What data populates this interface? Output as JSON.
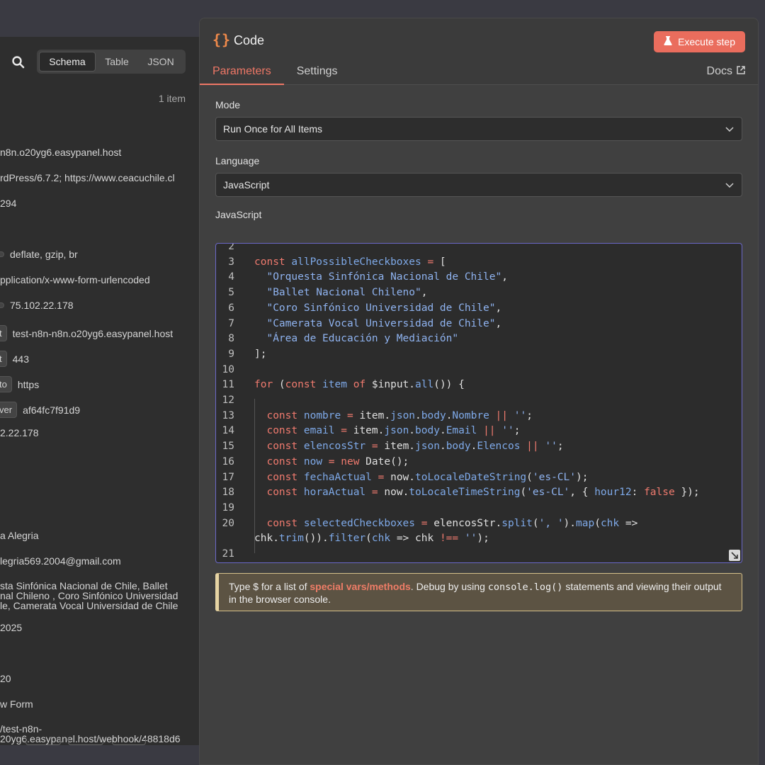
{
  "left_panel": {
    "view_tabs": [
      "Schema",
      "Table",
      "JSON"
    ],
    "active_view": "Schema",
    "item_count": "1 item",
    "rows": [
      {
        "text": "n8n.o20yg6.easypanel.host"
      },
      {
        "text": "rdPress/6.7.2; https://www.ceacuchile.cl"
      },
      {
        "text": "294"
      },
      {
        "key": "",
        "text": "deflate, gzip, br"
      },
      {
        "text": "pplication/x-www-form-urlencoded"
      },
      {
        "key": "",
        "text": "75.102.22.178"
      },
      {
        "key": "t",
        "text": "test-n8n-n8n.o20yg6.easypanel.host"
      },
      {
        "key": "t",
        "text": "443"
      },
      {
        "key": "to",
        "text": "https"
      },
      {
        "key": "ver",
        "text": "af64fc7f91d9"
      },
      {
        "text": "2.22.178"
      },
      {
        "text": "a Alegria"
      },
      {
        "text": "legria569.2004@gmail.com"
      },
      {
        "text": "sta Sinfónica Nacional de Chile, Ballet\nnal Chileno , Coro Sinfónico Universidad\nle, Camerata Vocal Universidad de Chile"
      },
      {
        "text": "2025"
      },
      {
        "text": "20"
      },
      {
        "text": "w Form"
      },
      {
        "text": "/test-n8n-\n20yg6.easypanel.host/webhook/48818d6"
      }
    ]
  },
  "dialog": {
    "icon_glyph": "{}",
    "title": "Code",
    "execute_label": "Execute step",
    "tabs": [
      "Parameters",
      "Settings"
    ],
    "active_tab": "Parameters",
    "docs_label": "Docs",
    "mode_label": "Mode",
    "mode_value": "Run Once for All Items",
    "language_label": "Language",
    "language_value": "JavaScript",
    "code_label": "JavaScript",
    "code_lines": [
      {
        "n": "2",
        "tokens": []
      },
      {
        "n": "3",
        "tokens": [
          [
            "kw",
            "const "
          ],
          [
            "vr",
            "allPossibleCheckboxes"
          ],
          [
            "kw",
            " = "
          ],
          [
            "",
            "["
          ]
        ]
      },
      {
        "n": "4",
        "tokens": [
          [
            "",
            "  "
          ],
          [
            "st",
            "\"Orquesta Sinfónica Nacional de Chile\""
          ],
          [
            "",
            ","
          ]
        ]
      },
      {
        "n": "5",
        "tokens": [
          [
            "",
            "  "
          ],
          [
            "st",
            "\"Ballet Nacional Chileno\""
          ],
          [
            "",
            ","
          ]
        ]
      },
      {
        "n": "6",
        "tokens": [
          [
            "",
            "  "
          ],
          [
            "st",
            "\"Coro Sinfónico Universidad de Chile\""
          ],
          [
            "",
            ","
          ]
        ]
      },
      {
        "n": "7",
        "tokens": [
          [
            "",
            "  "
          ],
          [
            "st",
            "\"Camerata Vocal Universidad de Chile\""
          ],
          [
            "",
            ","
          ]
        ]
      },
      {
        "n": "8",
        "tokens": [
          [
            "",
            "  "
          ],
          [
            "st",
            "\"Área de Educación y Mediación\""
          ]
        ]
      },
      {
        "n": "9",
        "tokens": [
          [
            "",
            "];"
          ]
        ]
      },
      {
        "n": "10",
        "tokens": []
      },
      {
        "n": "11",
        "tokens": [
          [
            "kw",
            "for "
          ],
          [
            "",
            "("
          ],
          [
            "kw",
            "const "
          ],
          [
            "vr",
            "item "
          ],
          [
            "kw",
            "of "
          ],
          [
            "",
            "$input."
          ],
          [
            "fn",
            "all"
          ],
          [
            "",
            "()) {"
          ]
        ]
      },
      {
        "n": "12",
        "tokens": []
      },
      {
        "n": "13",
        "tokens": [
          [
            "",
            "  "
          ],
          [
            "kw",
            "const "
          ],
          [
            "vr",
            "nombre"
          ],
          [
            "kw",
            " = "
          ],
          [
            "",
            "item."
          ],
          [
            "fn",
            "json"
          ],
          [
            "",
            "."
          ],
          [
            "fn",
            "body"
          ],
          [
            "",
            "."
          ],
          [
            "fn",
            "Nombre"
          ],
          [
            "kw",
            " || "
          ],
          [
            "st",
            "''"
          ],
          [
            "",
            ";"
          ]
        ]
      },
      {
        "n": "14",
        "tokens": [
          [
            "",
            "  "
          ],
          [
            "kw",
            "const "
          ],
          [
            "vr",
            "email"
          ],
          [
            "kw",
            " = "
          ],
          [
            "",
            "item."
          ],
          [
            "fn",
            "json"
          ],
          [
            "",
            "."
          ],
          [
            "fn",
            "body"
          ],
          [
            "",
            "."
          ],
          [
            "fn",
            "Email"
          ],
          [
            "kw",
            " || "
          ],
          [
            "st",
            "''"
          ],
          [
            "",
            ";"
          ]
        ]
      },
      {
        "n": "15",
        "tokens": [
          [
            "",
            "  "
          ],
          [
            "kw",
            "const "
          ],
          [
            "vr",
            "elencosStr"
          ],
          [
            "kw",
            " = "
          ],
          [
            "",
            "item."
          ],
          [
            "fn",
            "json"
          ],
          [
            "",
            "."
          ],
          [
            "fn",
            "body"
          ],
          [
            "",
            "."
          ],
          [
            "fn",
            "Elencos"
          ],
          [
            "kw",
            " || "
          ],
          [
            "st",
            "''"
          ],
          [
            "",
            ";"
          ]
        ]
      },
      {
        "n": "16",
        "tokens": [
          [
            "",
            "  "
          ],
          [
            "kw",
            "const "
          ],
          [
            "vr",
            "now"
          ],
          [
            "kw",
            " = new "
          ],
          [
            "",
            "Date();"
          ]
        ]
      },
      {
        "n": "17",
        "tokens": [
          [
            "",
            "  "
          ],
          [
            "kw",
            "const "
          ],
          [
            "vr",
            "fechaActual"
          ],
          [
            "kw",
            " = "
          ],
          [
            "",
            "now."
          ],
          [
            "fn",
            "toLocaleDateString"
          ],
          [
            "",
            "("
          ],
          [
            "st",
            "'es-CL'"
          ],
          [
            "",
            ");"
          ]
        ]
      },
      {
        "n": "18",
        "tokens": [
          [
            "",
            "  "
          ],
          [
            "kw",
            "const "
          ],
          [
            "vr",
            "horaActual"
          ],
          [
            "kw",
            " = "
          ],
          [
            "",
            "now."
          ],
          [
            "fn",
            "toLocaleTimeString"
          ],
          [
            "",
            "("
          ],
          [
            "st",
            "'es-CL'"
          ],
          [
            "",
            ", { "
          ],
          [
            "vr",
            "hour12"
          ],
          [
            "",
            ": "
          ],
          [
            "kw",
            "false"
          ],
          [
            "",
            " });"
          ]
        ]
      },
      {
        "n": "19",
        "tokens": []
      },
      {
        "n": "20",
        "tokens": [
          [
            "",
            "  "
          ],
          [
            "kw",
            "const "
          ],
          [
            "vr",
            "selectedCheckboxes"
          ],
          [
            "kw",
            " = "
          ],
          [
            "",
            "elencosStr."
          ],
          [
            "fn",
            "split"
          ],
          [
            "",
            "("
          ],
          [
            "st",
            "', '"
          ],
          [
            "",
            ")."
          ],
          [
            "fn",
            "map"
          ],
          [
            "",
            "("
          ],
          [
            "vr",
            "chk"
          ],
          [
            "",
            " =>"
          ]
        ]
      },
      {
        "n": "",
        "tokens": [
          [
            "",
            "chk."
          ],
          [
            "fn",
            "trim"
          ],
          [
            "",
            "())."
          ],
          [
            "fn",
            "filter"
          ],
          [
            "",
            "("
          ],
          [
            "vr",
            "chk"
          ],
          [
            "",
            " => chk "
          ],
          [
            "kw",
            "!=="
          ],
          [
            "",
            " "
          ],
          [
            "st",
            "''"
          ],
          [
            "",
            ");"
          ]
        ]
      },
      {
        "n": "21",
        "tokens": []
      }
    ],
    "hint": {
      "pre": "Type $ for a list of ",
      "link": "special vars/methods",
      "mid": ". Debug by using ",
      "code": "console.log()",
      "post": " statements and viewing their output in the browser console."
    },
    "colors": {
      "accent": "#ea6d5d",
      "tab_active": "#ee7766",
      "editor_focus": "#6b68c8"
    }
  }
}
